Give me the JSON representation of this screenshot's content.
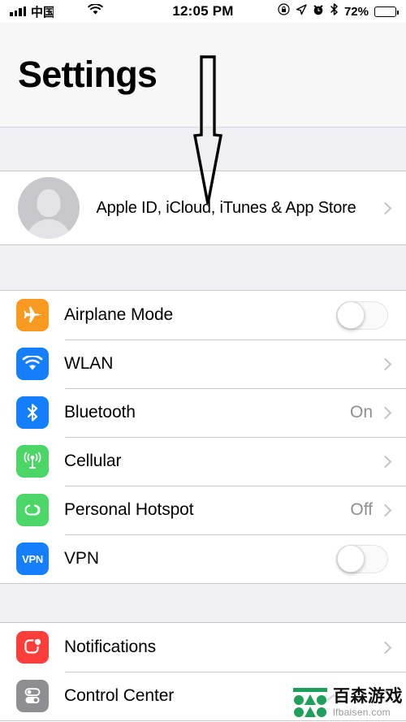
{
  "status_bar": {
    "carrier": "中国",
    "signal_icon": "signal-bars-icon",
    "wifi_icon": "wifi-icon",
    "time": "12:05 PM",
    "rotation_lock_icon": "rotation-lock-icon",
    "location_icon": "location-arrow-icon",
    "alarm_icon": "alarm-clock-icon",
    "bluetooth_icon": "bluetooth-icon",
    "battery_percent": "72%",
    "battery_icon": "battery-icon"
  },
  "header": {
    "title": "Settings"
  },
  "annotation": {
    "arrow": "down-arrow-annotation",
    "color": "#000000"
  },
  "account": {
    "avatar_icon": "avatar-placeholder-icon",
    "label": "Apple ID, iCloud, iTunes & App Store",
    "chevron_icon": "chevron-right-icon"
  },
  "sections": [
    {
      "name": "connectivity",
      "rows": [
        {
          "id": "airplane-mode",
          "label": "Airplane Mode",
          "icon": "airplane-icon",
          "icon_color": "#F79A1F",
          "control": "toggle",
          "toggle_on": false
        },
        {
          "id": "wlan",
          "label": "WLAN",
          "icon": "wifi-icon",
          "icon_color": "#147EFB",
          "control": "chevron",
          "value": ""
        },
        {
          "id": "bluetooth",
          "label": "Bluetooth",
          "icon": "bluetooth-icon",
          "icon_color": "#147EFB",
          "control": "chevron",
          "value": "On"
        },
        {
          "id": "cellular",
          "label": "Cellular",
          "icon": "cellular-antenna-icon",
          "icon_color": "#4CD667",
          "control": "chevron",
          "value": ""
        },
        {
          "id": "personal-hotspot",
          "label": "Personal Hotspot",
          "icon": "hotspot-link-icon",
          "icon_color": "#4CD667",
          "control": "chevron",
          "value": "Off"
        },
        {
          "id": "vpn",
          "label": "VPN",
          "icon": "vpn-icon",
          "icon_color": "#147EFB",
          "icon_text": "VPN",
          "control": "toggle",
          "toggle_on": false
        }
      ]
    },
    {
      "name": "system",
      "rows": [
        {
          "id": "notifications",
          "label": "Notifications",
          "icon": "notifications-icon",
          "icon_color": "#FC3D39",
          "control": "chevron",
          "value": ""
        },
        {
          "id": "control-center",
          "label": "Control Center",
          "icon": "control-center-icon",
          "icon_color": "#8E8E93",
          "control": "chevron",
          "value": ""
        }
      ]
    }
  ],
  "watermark": {
    "brand": "百森游戏",
    "url": "lfbaisen.com",
    "logo_color": "#1EA05A"
  }
}
